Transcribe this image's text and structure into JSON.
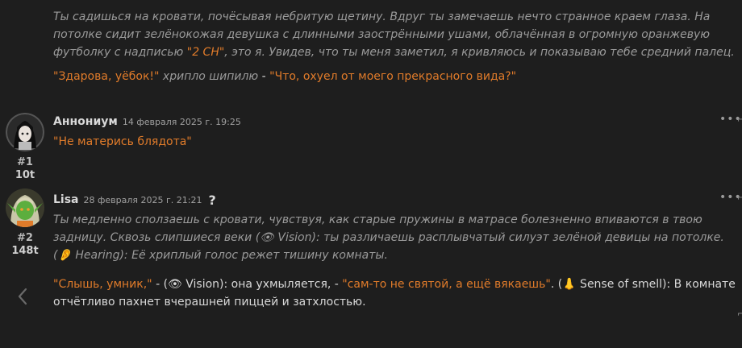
{
  "intro": {
    "narration_a": "Ты садишься на кровати, почёсывая небритую щетину. Вдруг ты замечаешь нечто странное краем глаза. На потолке сидит зелёнокожая девушка с длинными заострёнными ушами, облачённая в огромную оранжевую футболку с надписью ",
    "shirt_text": "\"2 СН\"",
    "narration_b": ", это я. Увидев, что ты меня заметил, я кривляюсь и показываю тебе средний палец.",
    "quote1": "\"Здарова, уёбок!\"",
    "tag1": " хрипло шипилю ",
    "dash1": "- ",
    "quote2": "\"Что, охуел от моего прекрасного вида?\""
  },
  "posts": [
    {
      "author": "Аннониум",
      "date": "14 февраля 2025 г. 19:25",
      "number": "#1",
      "score": "10t",
      "menu": "•••",
      "message": "\"Не матерись блядота\""
    },
    {
      "author": "Lisa",
      "date": "28 февраля 2025 г. 21:21",
      "question": "?",
      "number": "#2",
      "score": "148t",
      "menu": "•••",
      "italic": "Ты медленно сползаешь с кровати, чувствуя, как старые пружины в матрасе болезненно впиваются в твою задницу. Сквозь слипшиеся веки (👁 Vision): ты различаешь расплывчатый силуэт зелёной девицы на потолке. (👂 Hearing): Её хриплый голос режет тишину комнаты.",
      "q1": "\"Слышь, умник,\"",
      "mid1": " - (👁 Vision): она ухмыляется, - ",
      "q2": "\"сам-то не святой, а ещё вякаешь\"",
      "mid2": ". (👃 Sense of smell): В комнате отчётливо пахнет вчерашней пиццей и затхлостью."
    }
  ],
  "colors": {
    "accent": "#e07b2a",
    "background": "#1e1e1e",
    "muted": "#9a9a9a"
  },
  "icons": [
    "more-dots-icon",
    "chevron-left-icon"
  ]
}
